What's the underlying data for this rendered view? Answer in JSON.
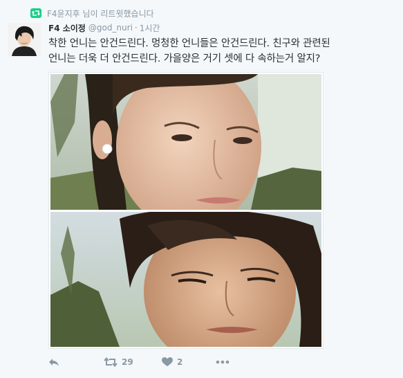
{
  "retweet": {
    "icon": "retweet-badge-icon",
    "text": "F4윤지후 님이 리트윗했습니다",
    "accent": "#19cf86"
  },
  "user": {
    "display_name": "F4 소이정",
    "handle": "@god_nuri",
    "time": "1시간",
    "avatar": "avatar-image"
  },
  "tweet": {
    "text_line1": "착한 언니는 안건드린다. 멍청한 언니들은 안건드린다. 친구와 관련된",
    "text_line2": "언니는 더욱 더 안건드린다. 가을양은 거기 셋에 다 속하는거 알지?"
  },
  "media": {
    "photos": [
      "photo-woman-closeup",
      "photo-man-closeup"
    ]
  },
  "actions": {
    "reply_icon": "reply-icon",
    "retweet_icon": "retweet-icon",
    "retweet_count": "29",
    "like_icon": "heart-icon",
    "like_count": "2",
    "more_icon": "more-dots-icon"
  },
  "colors": {
    "text": "#292f33",
    "muted": "#8899a6",
    "background": "#f5f8fa"
  }
}
